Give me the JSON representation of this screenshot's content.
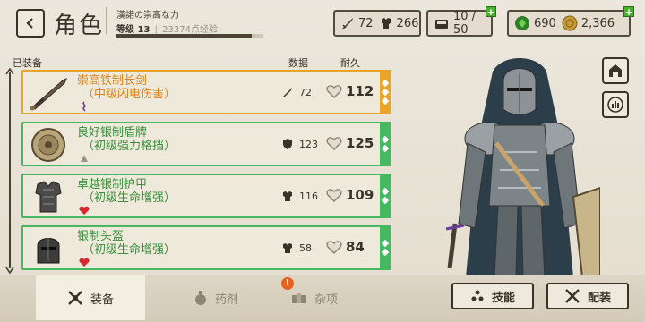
{
  "header": {
    "back_icon": "chevron-left-icon",
    "title": "角色",
    "player_name": "漢諾の崇高な力",
    "level_label": "等级 13",
    "xp_separator": "|",
    "xp_text": "23374点经验",
    "xp_progress": 0.92
  },
  "stats": {
    "attack": "72",
    "armor": "266",
    "inventory": "10 / 50",
    "gems": "690",
    "gold": "2,366"
  },
  "list": {
    "section_label": "已装备",
    "col_data": "数据",
    "col_durability": "耐久",
    "items": [
      {
        "name": "崇高铁制长剑",
        "subtitle": "（中级闪电伤害）",
        "stat": "72",
        "durability": "112",
        "rarity_color": "#e8a52a"
      },
      {
        "name": "良好银制盾牌",
        "subtitle": "（初级强力格挡）",
        "stat": "123",
        "durability": "125",
        "rarity_color": "#46b862"
      },
      {
        "name": "卓越银制护甲",
        "subtitle": "（初级生命增强）",
        "stat": "116",
        "durability": "109",
        "rarity_color": "#46b862"
      },
      {
        "name": "银制头盔",
        "subtitle": "（初级生命增强）",
        "stat": "58",
        "durability": "84",
        "rarity_color": "#46b862"
      }
    ]
  },
  "tabs": {
    "equipment": "装备",
    "potions": "药剂",
    "misc": "杂项",
    "misc_badge": "!"
  },
  "actions": {
    "skills": "技能",
    "loadout": "配装"
  },
  "colors": {
    "accent_orange": "#e8a52a",
    "accent_green": "#46b862",
    "plus_green": "#4ab12c",
    "dark_ink": "#3a3228"
  }
}
